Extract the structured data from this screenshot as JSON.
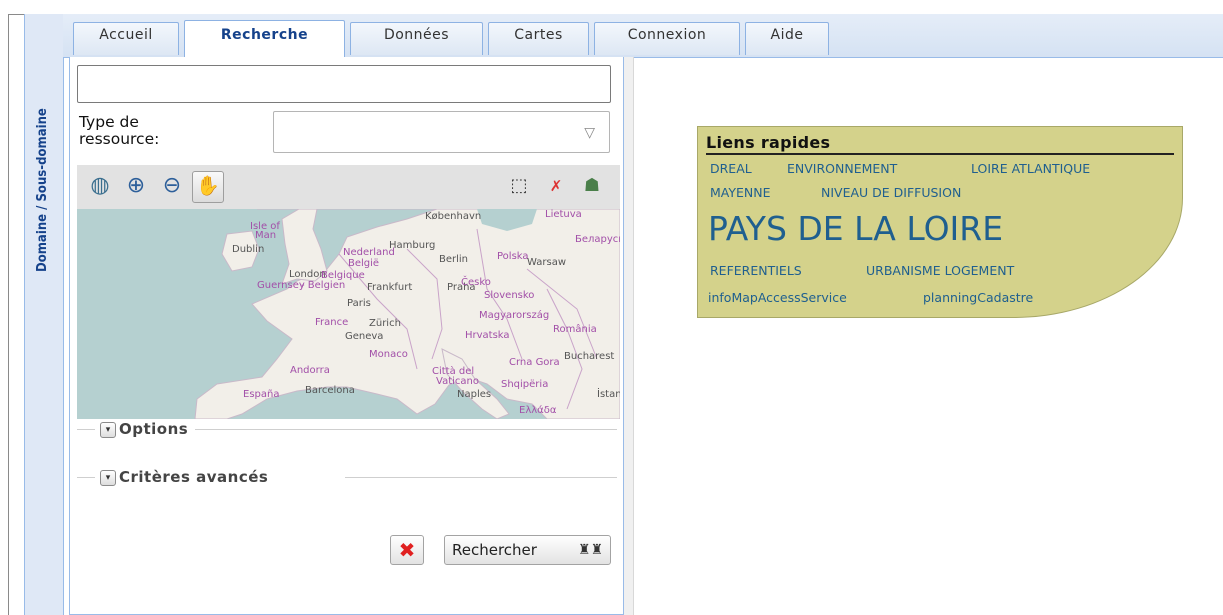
{
  "side": {
    "title": "Domaine / Sous-domaine"
  },
  "tabs": [
    {
      "label": "Accueil"
    },
    {
      "label": "Recherche"
    },
    {
      "label": "Données"
    },
    {
      "label": "Cartes"
    },
    {
      "label": "Connexion"
    },
    {
      "label": "Aide"
    }
  ],
  "search": {
    "query": "",
    "type_label_line1": "Type de",
    "type_label_line2": "ressource:",
    "type_value": ""
  },
  "map": {
    "tools": [
      "zoom-extent-icon",
      "zoom-in-icon",
      "zoom-out-icon",
      "pan-hand-icon",
      "box-select-icon",
      "clear-selection-icon",
      "layers-icon"
    ],
    "labels": [
      "Isle of",
      "Man",
      "Dublin",
      "København",
      "Lietuva",
      "Беларусь",
      "Nederland",
      "Hamburg",
      "Berlin",
      "Polska",
      "Warsaw",
      "België",
      "London",
      "Belgique",
      "Guernsey",
      "- Belgien",
      "Frankfurt",
      "Praha",
      "Česko",
      "Slovensko",
      "Paris",
      "Magyarország",
      "France",
      "Zürich",
      "Hrvatska",
      "România",
      "Geneva",
      "Monaco",
      "Crna Gora",
      "Bucharest",
      "Andorra",
      "Città del",
      "Vaticano",
      "Shqipëria",
      "España",
      "Barcelona",
      "Naples",
      "Ελλάδα",
      "İstanbul"
    ]
  },
  "fieldsets": {
    "options": "Options",
    "advanced": "Critères avancés"
  },
  "buttons": {
    "search": "Rechercher"
  },
  "quick_links": {
    "title": "Liens rapides",
    "tags": [
      "DREAL",
      "ENVIRONNEMENT",
      "LOIRE ATLANTIQUE",
      "MAYENNE",
      "NIVEAU DE DIFFUSION",
      "PAYS DE LA LOIRE",
      "REFERENTIELS",
      "URBANISME LOGEMENT",
      "infoMapAccessService",
      "planningCadastre"
    ]
  },
  "colors": {
    "accent": "#15428b",
    "tab_border": "#8db2e3",
    "quick_bg": "#d4d28b",
    "tag_text": "#1f5f8f"
  }
}
